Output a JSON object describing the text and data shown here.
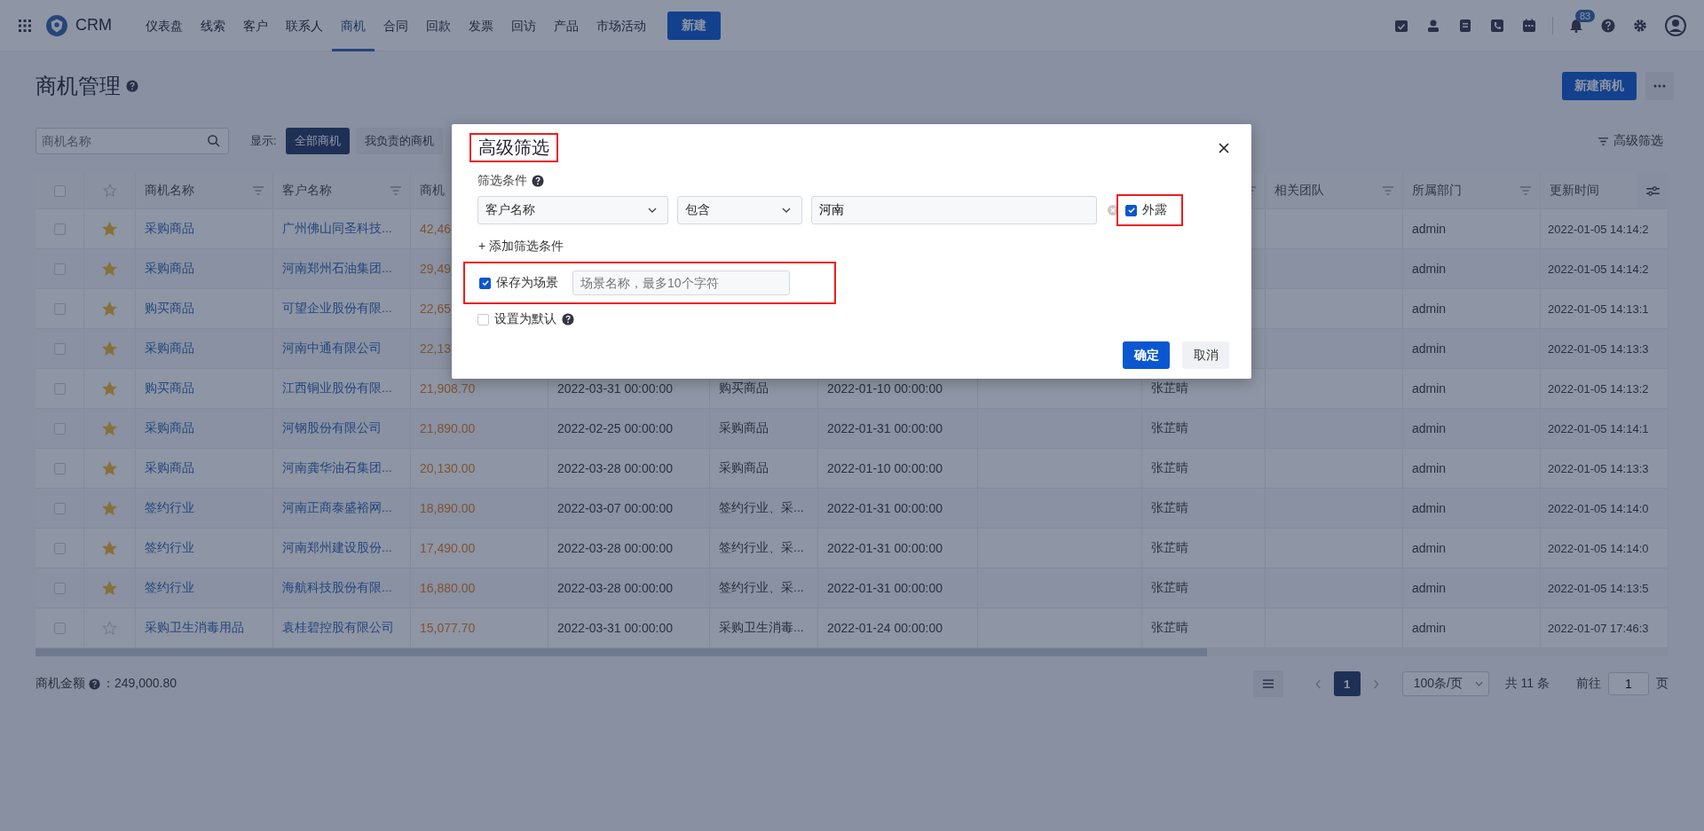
{
  "nav": {
    "logo": "CRM",
    "items": [
      {
        "label": "仪表盘",
        "selected": false
      },
      {
        "label": "线索",
        "selected": false
      },
      {
        "label": "客户",
        "selected": false
      },
      {
        "label": "联系人",
        "selected": false
      },
      {
        "label": "商机",
        "selected": true
      },
      {
        "label": "合同",
        "selected": false
      },
      {
        "label": "回款",
        "selected": false
      },
      {
        "label": "发票",
        "selected": false
      },
      {
        "label": "回访",
        "selected": false
      },
      {
        "label": "产品",
        "selected": false
      },
      {
        "label": "市场活动",
        "selected": false
      }
    ],
    "new_button": "新建",
    "notification_badge": "83"
  },
  "header": {
    "title": "商机管理",
    "new_button": "新建商机"
  },
  "filters": {
    "search": {
      "placeholder": "商机名称"
    },
    "show_label": "显示:",
    "scopes": [
      {
        "label": "全部商机",
        "selected": true
      },
      {
        "label": "我负责的商机",
        "selected": false
      }
    ],
    "advanced": "高级筛选"
  },
  "table": {
    "select_all_checked": false,
    "columns": [
      "商机名称",
      "客户名称",
      "商机",
      null,
      null,
      null,
      null,
      null,
      "相关团队",
      "所属部门",
      "更新时间"
    ],
    "rows": [
      {
        "checked": false,
        "starred": true,
        "cells": [
          "采购商品",
          "广州佛山同圣科技...",
          "42,46",
          null,
          null,
          null,
          null,
          null,
          null,
          "admin",
          "2022-01-05 14:14:2"
        ]
      },
      {
        "checked": false,
        "starred": true,
        "cells": [
          "采购商品",
          "河南郑州石油集团...",
          "29,49",
          null,
          null,
          null,
          null,
          null,
          null,
          "admin",
          "2022-01-05 14:14:2"
        ]
      },
      {
        "checked": false,
        "starred": true,
        "cells": [
          "购买商品",
          "可望企业股份有限...",
          "22,65",
          null,
          null,
          null,
          null,
          null,
          null,
          "admin",
          "2022-01-05 14:13:1"
        ]
      },
      {
        "checked": false,
        "starred": true,
        "cells": [
          "采购商品",
          "河南中通有限公司",
          "22,13",
          null,
          null,
          null,
          null,
          null,
          null,
          "admin",
          "2022-01-05 14:13:3"
        ]
      },
      {
        "checked": false,
        "starred": true,
        "cells": [
          "购买商品",
          "江西铜业股份有限...",
          "21,908.70",
          "2022-03-31 00:00:00",
          "购买商品",
          "2022-01-10 00:00:00",
          null,
          "张芷晴",
          null,
          "admin",
          "2022-01-05 14:13:2"
        ]
      },
      {
        "checked": false,
        "starred": true,
        "cells": [
          "采购商品",
          "河钢股份有限公司",
          "21,890.00",
          "2022-02-25 00:00:00",
          "采购商品",
          "2022-01-31 00:00:00",
          null,
          "张芷晴",
          null,
          "admin",
          "2022-01-05 14:14:1"
        ]
      },
      {
        "checked": false,
        "starred": true,
        "cells": [
          "采购商品",
          "河南龚华油石集团...",
          "20,130.00",
          "2022-03-28 00:00:00",
          "采购商品",
          "2022-01-10 00:00:00",
          null,
          "张芷晴",
          null,
          "admin",
          "2022-01-05 14:13:3"
        ]
      },
      {
        "checked": false,
        "starred": true,
        "cells": [
          "签约行业",
          "河南正商泰盛裕网...",
          "18,890.00",
          "2022-03-07 00:00:00",
          "签约行业、采...",
          "2022-01-31 00:00:00",
          null,
          "张芷晴",
          null,
          "admin",
          "2022-01-05 14:14:0"
        ]
      },
      {
        "checked": false,
        "starred": true,
        "cells": [
          "签约行业",
          "河南郑州建设股份...",
          "17,490.00",
          "2022-03-28 00:00:00",
          "签约行业、采...",
          "2022-01-31 00:00:00",
          null,
          "张芷晴",
          null,
          "admin",
          "2022-01-05 14:14:0"
        ]
      },
      {
        "checked": false,
        "starred": true,
        "cells": [
          "签约行业",
          "海航科技股份有限...",
          "16,880.00",
          "2022-03-28 00:00:00",
          "签约行业、采...",
          "2022-01-31 00:00:00",
          null,
          "张芷晴",
          null,
          "admin",
          "2022-01-05 14:13:5"
        ]
      },
      {
        "checked": false,
        "starred": false,
        "cells": [
          "采购卫生消毒用品",
          "袁桂碧控股有限公司",
          "15,077.70",
          "2022-03-31 00:00:00",
          "采购卫生消毒...",
          "2022-01-24 00:00:00",
          null,
          "张芷晴",
          null,
          "admin",
          "2022-01-07 17:46:3"
        ]
      }
    ]
  },
  "footer": {
    "total_label": "商机金额",
    "total_value": "：249,000.80",
    "page": "1",
    "page_size": "100条/页",
    "count": "共 11 条",
    "goto_label": "前往",
    "goto_value": "1",
    "goto_unit": "页"
  },
  "dialog": {
    "title": "高级筛选",
    "conditions_label": "筛选条件",
    "condition": {
      "field": "客户名称",
      "operator": "包含",
      "value": "河南",
      "exposed": {
        "label": "外露",
        "checked": true
      }
    },
    "add_condition": "+ 添加筛选条件",
    "save_scene": {
      "label": "保存为场景",
      "checked": true,
      "placeholder": "场景名称，最多10个字符"
    },
    "set_default": {
      "label": "设置为默认",
      "checked": false
    },
    "ok": "确定",
    "cancel": "取消"
  }
}
